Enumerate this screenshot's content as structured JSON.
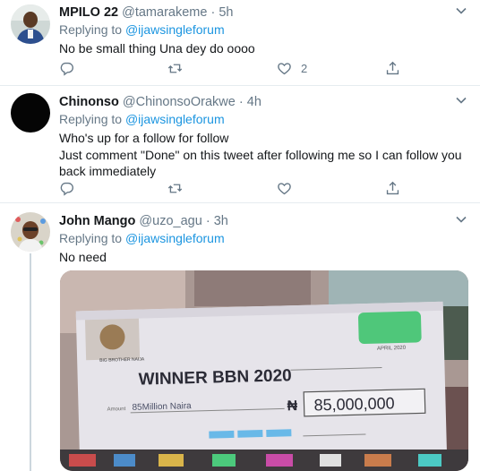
{
  "tweets": [
    {
      "name": "MPILO 22",
      "handle": "@tamarakeme",
      "time": "5h",
      "replying_prefix": "Replying to",
      "replying_to": "@ijawsingleforum",
      "text_lines": [
        "No be small thing Una dey do oooo"
      ],
      "likes": "2"
    },
    {
      "name": "Chinonso",
      "handle": "@ChinonsoOrakwe",
      "time": "4h",
      "replying_prefix": "Replying to",
      "replying_to": "@ijawsingleforum",
      "text_lines": [
        "Who's up for a follow for follow",
        "Just comment \"Done\" on this tweet after following me so I can follow you",
        "back immediately"
      ],
      "likes": ""
    },
    {
      "name": "John Mango",
      "handle": "@uzo_agu",
      "time": "3h",
      "replying_prefix": "Replying to",
      "replying_to": "@ijawsingleforum",
      "text_lines": [
        "No need"
      ],
      "likes": ""
    }
  ],
  "separator": "·",
  "media": {
    "headline": "WINNER BBN 2020",
    "amount_label": "Amount",
    "amount_words": "85Million Naira",
    "currency": "₦",
    "amount_box": "85,000,000",
    "date": "APRIL 2020",
    "brand": "BIG BROTHER NAIJA"
  },
  "colors": {
    "accent": "#1b95e0",
    "muted": "#657786",
    "border": "#e6ecf0",
    "thread_line": "#ccd6dd"
  },
  "icons": [
    "reply-icon",
    "retweet-icon",
    "like-icon",
    "share-icon",
    "chevron-down-icon"
  ]
}
